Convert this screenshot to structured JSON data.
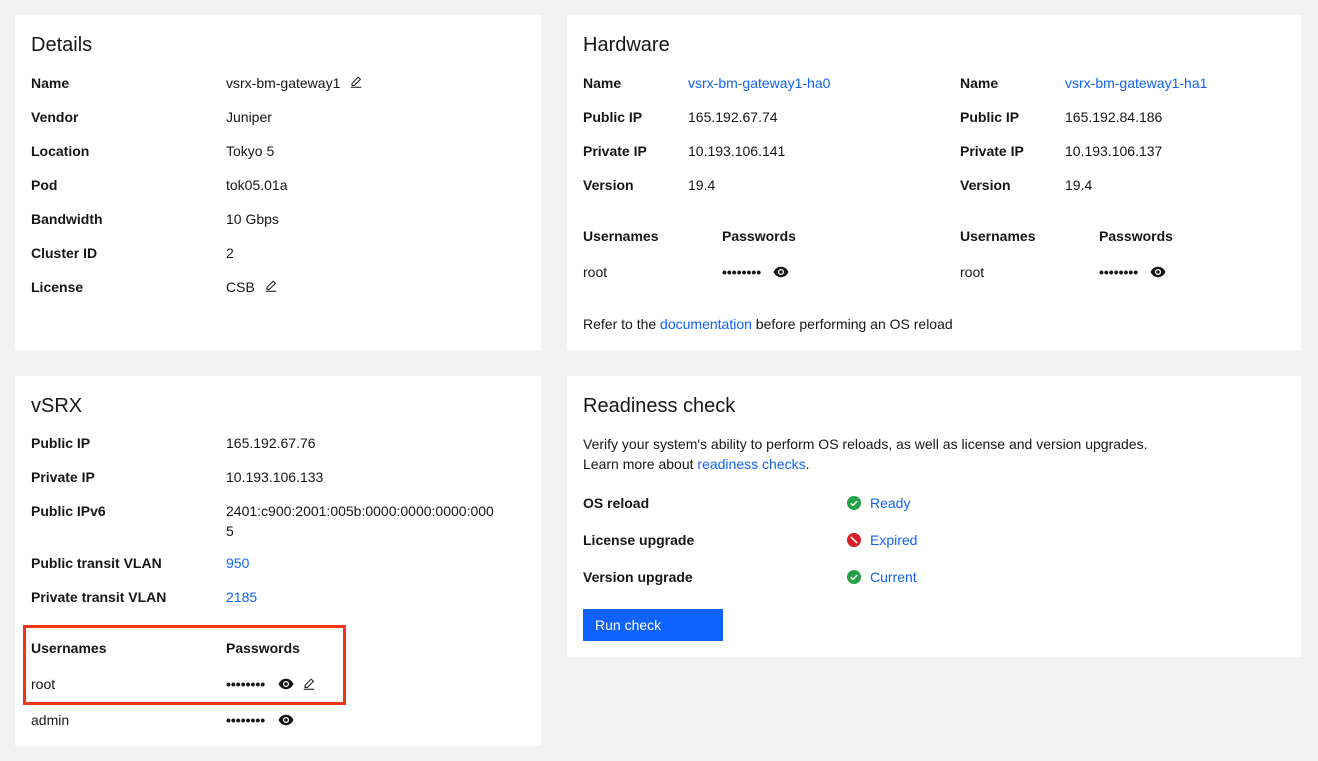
{
  "details": {
    "title": "Details",
    "name_label": "Name",
    "name_value": "vsrx-bm-gateway1",
    "vendor_label": "Vendor",
    "vendor_value": "Juniper",
    "location_label": "Location",
    "location_value": "Tokyo 5",
    "pod_label": "Pod",
    "pod_value": "tok05.01a",
    "bandwidth_label": "Bandwidth",
    "bandwidth_value": "10 Gbps",
    "cluster_label": "Cluster ID",
    "cluster_value": "2",
    "license_label": "License",
    "license_value": "CSB"
  },
  "hardware": {
    "title": "Hardware",
    "nodes": [
      {
        "name_label": "Name",
        "name_value": "vsrx-bm-gateway1-ha0",
        "public_ip_label": "Public IP",
        "public_ip_value": "165.192.67.74",
        "private_ip_label": "Private IP",
        "private_ip_value": "10.193.106.141",
        "version_label": "Version",
        "version_value": "19.4",
        "usernames_header": "Usernames",
        "passwords_header": "Passwords",
        "username": "root",
        "password_mask": "••••••••"
      },
      {
        "name_label": "Name",
        "name_value": "vsrx-bm-gateway1-ha1",
        "public_ip_label": "Public IP",
        "public_ip_value": "165.192.84.186",
        "private_ip_label": "Private IP",
        "private_ip_value": "10.193.106.137",
        "version_label": "Version",
        "version_value": "19.4",
        "usernames_header": "Usernames",
        "passwords_header": "Passwords",
        "username": "root",
        "password_mask": "••••••••"
      }
    ],
    "note_prefix": "Refer to the ",
    "note_link": "documentation",
    "note_suffix": " before performing an OS reload"
  },
  "vsrx": {
    "title": "vSRX",
    "public_ip_label": "Public IP",
    "public_ip_value": "165.192.67.76",
    "private_ip_label": "Private IP",
    "private_ip_value": "10.193.106.133",
    "public_ipv6_label": "Public IPv6",
    "public_ipv6_value_line1": "2401:c900:2001:005b:0000:0000:0000:000",
    "public_ipv6_value_line2": "5",
    "public_vlan_label": "Public transit VLAN",
    "public_vlan_value": "950",
    "private_vlan_label": "Private transit VLAN",
    "private_vlan_value": "2185",
    "usernames_header": "Usernames",
    "passwords_header": "Passwords",
    "credentials": [
      {
        "username": "root",
        "password_mask": "••••••••"
      },
      {
        "username": "admin",
        "password_mask": "••••••••"
      }
    ]
  },
  "readiness": {
    "title": "Readiness check",
    "description_line1": "Verify your system's ability to perform OS reloads, as well as license and version upgrades.",
    "description_prefix": "Learn more about ",
    "description_link": "readiness checks",
    "description_suffix": ".",
    "checks": [
      {
        "label": "OS reload",
        "status": "Ready",
        "state": "success"
      },
      {
        "label": "License upgrade",
        "status": "Expired",
        "state": "error"
      },
      {
        "label": "Version upgrade",
        "status": "Current",
        "state": "success"
      }
    ],
    "run_button": "Run check"
  },
  "colors": {
    "background": "#f2f2f2",
    "card": "#ffffff",
    "link": "#0f62fe",
    "success": "#24a148",
    "error": "#da1e28",
    "highlight": "#f5321b",
    "primary_button": "#0f62fe"
  }
}
